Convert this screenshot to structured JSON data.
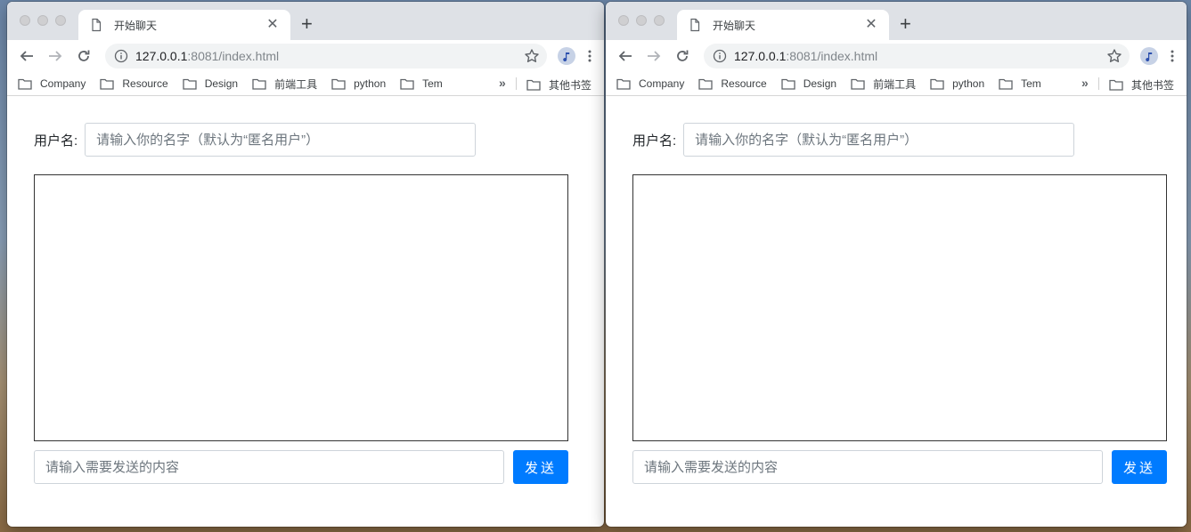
{
  "colors": {
    "accent": "#007bff",
    "tab_strip": "#dee1e6",
    "omnibox": "#f1f3f4"
  },
  "browser": {
    "tab_title": "开始聊天",
    "url_host": "127.0.0.1",
    "url_rest": ":8081/index.html",
    "bookmarks": [
      "Company",
      "Resource",
      "Design",
      "前端工具",
      "python",
      "Tem"
    ],
    "bookmarks_more": "»",
    "other_bookmarks": "其他书签"
  },
  "page": {
    "name_label": "用户名:",
    "name_placeholder": "请输入你的名字（默认为“匿名用户”）",
    "message_placeholder": "请输入需要发送的内容",
    "send_label": "发送"
  }
}
